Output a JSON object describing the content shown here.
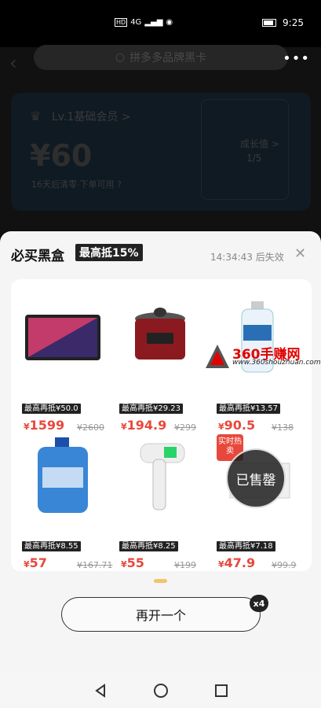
{
  "status": {
    "time": "9:25",
    "net": "4G",
    "hd": "HD"
  },
  "background": {
    "search_placeholder": "拼多多品牌黑卡",
    "member_level": "Lv.1基础会员 >",
    "price": "¥60",
    "expire_note": "16天后清零·下单可用 ?",
    "growth_label": "成长值 >",
    "growth_value": "1/5"
  },
  "sheet": {
    "title": "必买黑盒",
    "badge": "最高抵15%",
    "expire": "14:34:43 后失效",
    "items": [
      {
        "tag": "最高再抵¥50.0",
        "price": "1599",
        "orig": "¥2600",
        "name": "tablet"
      },
      {
        "tag": "最高再抵¥29.23",
        "price": "194.9",
        "orig": "¥299",
        "name": "pressure-cooker"
      },
      {
        "tag": "最高再抵¥13.57",
        "price": "90.5",
        "orig": "¥138",
        "name": "milk-bottle"
      },
      {
        "tag": "最高再抵¥8.55",
        "price": "57",
        "orig": "¥167.71",
        "name": "detergent"
      },
      {
        "tag": "最高再抵¥8.25",
        "price": "55",
        "orig": "¥199",
        "name": "thermometer"
      },
      {
        "tag": "最高再抵¥7.18",
        "price": "47.9",
        "orig": "¥99.9",
        "name": "hot-item"
      }
    ],
    "currency": "¥",
    "sold_label": "已售罄",
    "hot_label": "实时热卖",
    "again_button": "再开一个",
    "count_badge": "x4"
  },
  "watermark": {
    "text": "360手赚网",
    "url": "www.360shouzhuan.com"
  }
}
